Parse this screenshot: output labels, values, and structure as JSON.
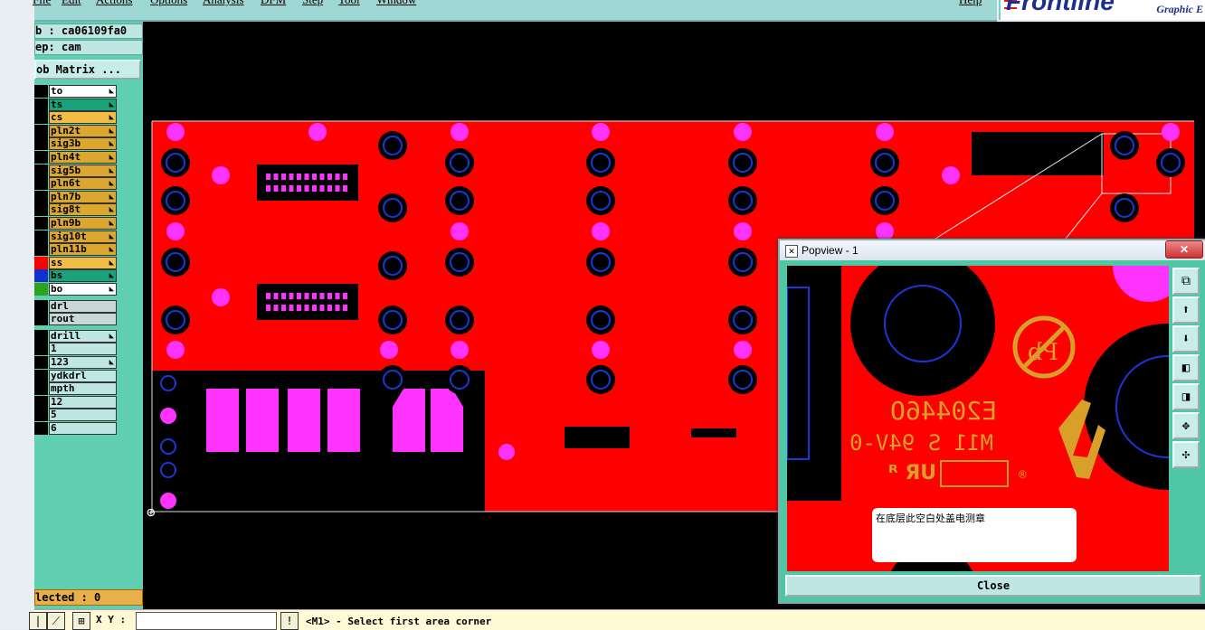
{
  "menubar": {
    "items": [
      "File",
      "Edit",
      "Actions",
      "Options",
      "Analysis",
      "DFM",
      "Step",
      "Tool",
      "Window"
    ],
    "help": "Help"
  },
  "logo": {
    "brand": "Frontline",
    "subtitle": "Graphic E"
  },
  "panel": {
    "job": "b : ca06109fa0",
    "step": "ep: cam",
    "matrix_button": "ob Matrix ..."
  },
  "layers": [
    {
      "name": "to",
      "color": "#ffffff",
      "swatch": "#000000"
    },
    {
      "name": "ts",
      "color": "#1aa37a",
      "swatch": "#000000"
    },
    {
      "name": "cs",
      "color": "#f2bc45",
      "swatch": "#000000"
    },
    {
      "name": "pln2t",
      "color": "#dba72e",
      "swatch": "#000000"
    },
    {
      "name": "sig3b",
      "color": "#dba72e",
      "swatch": "#000000"
    },
    {
      "name": "pln4t",
      "color": "#dba72e",
      "swatch": "#000000"
    },
    {
      "name": "sig5b",
      "color": "#dba72e",
      "swatch": "#000000"
    },
    {
      "name": "pln6t",
      "color": "#dba72e",
      "swatch": "#000000"
    },
    {
      "name": "pln7b",
      "color": "#dba72e",
      "swatch": "#000000"
    },
    {
      "name": "sig8t",
      "color": "#dba72e",
      "swatch": "#000000"
    },
    {
      "name": "pln9b",
      "color": "#dba72e",
      "swatch": "#000000"
    },
    {
      "name": "sig10t",
      "color": "#dba72e",
      "swatch": "#000000"
    },
    {
      "name": "pln11b",
      "color": "#dba72e",
      "swatch": "#000000"
    },
    {
      "name": "ss",
      "color": "#f2bc45",
      "swatch": "#ff0000"
    },
    {
      "name": "bs",
      "color": "#1aa37a",
      "swatch": "#1030d0"
    },
    {
      "name": "bo",
      "color": "#ffffff",
      "swatch": "#30a020"
    }
  ],
  "drill_layers": [
    "drl",
    "rout"
  ],
  "other_layers": [
    "drill",
    "1",
    "123",
    "ydkdrl",
    "mpth",
    "12",
    "5",
    "6"
  ],
  "selected_status": "lected : 0",
  "statusbar": {
    "xy_label": "X Y :",
    "xy_value": "",
    "message": "<M1> - Select first area corner"
  },
  "popup": {
    "title": "Popview - 1",
    "close_x": "✕",
    "close_button": "Close",
    "note_text": "在底层此空白处盖电测章",
    "silk_line1": "E20446O",
    "silk_line2": "M11 S 94V-0"
  },
  "colors": {
    "board": "#ff0000",
    "pad_magenta": "#ff33ff",
    "hole_blue": "#1a36d8",
    "silk_gold": "#d8a028",
    "panel_green": "#5fcfb0"
  }
}
